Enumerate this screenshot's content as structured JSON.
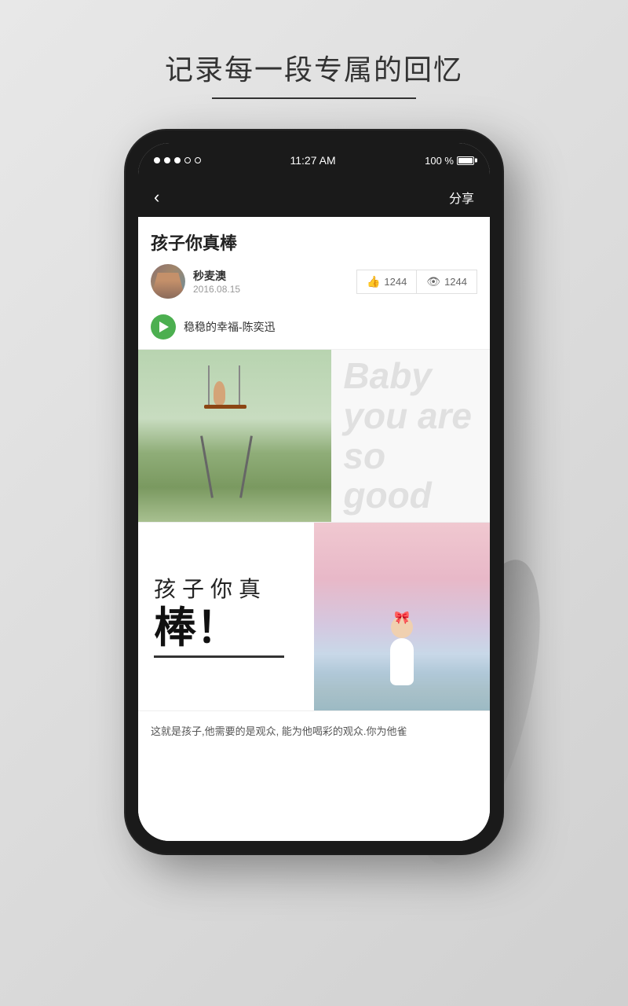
{
  "page": {
    "background_title": "记录每一段专属的回忆",
    "status": {
      "signal_dots": [
        "filled",
        "filled",
        "filled",
        "empty",
        "empty"
      ],
      "time": "11:27 AM",
      "battery_percent": "100 %"
    },
    "nav": {
      "back_label": "‹",
      "share_label": "分享"
    },
    "post": {
      "title": "孩子你真棒",
      "author": {
        "name": "秒麦澳",
        "date": "2016.08.15"
      },
      "stats": {
        "likes": "1244",
        "views": "1244"
      },
      "music": {
        "song_title": "稳稳的幸福-陈奕迅"
      },
      "image_right_text": {
        "line1": "Baby",
        "line2": "you are",
        "line3": "so good"
      },
      "text_block": {
        "line1": "孩子你真",
        "line2": "棒！"
      },
      "description": "这就是孩子,他需要的是观众,\n能为他喝彩的观众.你为他雀"
    }
  }
}
